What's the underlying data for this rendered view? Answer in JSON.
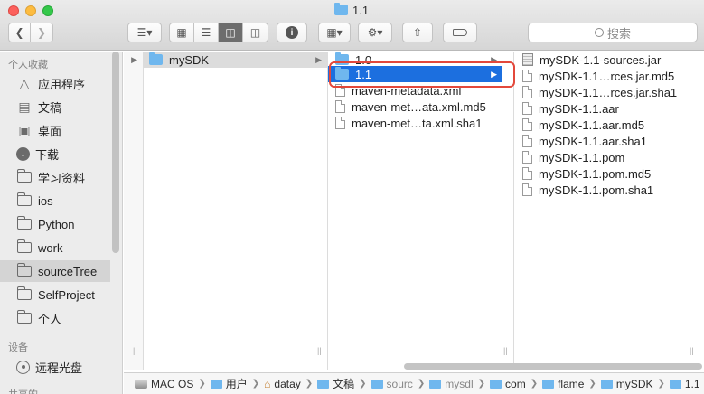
{
  "window": {
    "title": "1.1",
    "search_placeholder": "搜索"
  },
  "sidebar": {
    "sections": [
      {
        "label": "个人收藏"
      },
      {
        "label": "设备"
      },
      {
        "label": "共享的"
      }
    ],
    "items": [
      {
        "label": "应用程序",
        "icon": "apps-icon"
      },
      {
        "label": "文稿",
        "icon": "document-icon"
      },
      {
        "label": "桌面",
        "icon": "desktop-icon"
      },
      {
        "label": "下载",
        "icon": "download-icon"
      },
      {
        "label": "学习资料",
        "icon": "folder-icon"
      },
      {
        "label": "ios",
        "icon": "folder-icon"
      },
      {
        "label": "Python",
        "icon": "folder-icon"
      },
      {
        "label": "work",
        "icon": "folder-icon"
      },
      {
        "label": "sourceTree",
        "icon": "folder-icon",
        "selected": true
      },
      {
        "label": "SelfProject",
        "icon": "folder-icon"
      },
      {
        "label": "个人",
        "icon": "folder-icon"
      }
    ],
    "devices": [
      {
        "label": "远程光盘",
        "icon": "disc-icon"
      }
    ]
  },
  "columns": {
    "col1": [
      {
        "name": "mySDK",
        "type": "folder",
        "selected": true
      }
    ],
    "col2": [
      {
        "name": "1.0",
        "type": "folder"
      },
      {
        "name": "1.1",
        "type": "folder",
        "selected": true
      },
      {
        "name": "maven-metadata.xml",
        "type": "file"
      },
      {
        "name": "maven-met…ata.xml.md5",
        "type": "file"
      },
      {
        "name": "maven-met…ta.xml.sha1",
        "type": "file"
      }
    ],
    "col3": [
      {
        "name": "mySDK-1.1-sources.jar",
        "type": "jar"
      },
      {
        "name": "mySDK-1.1…rces.jar.md5",
        "type": "file"
      },
      {
        "name": "mySDK-1.1…rces.jar.sha1",
        "type": "file"
      },
      {
        "name": "mySDK-1.1.aar",
        "type": "file"
      },
      {
        "name": "mySDK-1.1.aar.md5",
        "type": "file"
      },
      {
        "name": "mySDK-1.1.aar.sha1",
        "type": "file"
      },
      {
        "name": "mySDK-1.1.pom",
        "type": "file"
      },
      {
        "name": "mySDK-1.1.pom.md5",
        "type": "file"
      },
      {
        "name": "mySDK-1.1.pom.sha1",
        "type": "file"
      }
    ]
  },
  "pathbar": [
    {
      "label": "MAC OS",
      "icon": "disk-icon"
    },
    {
      "label": "用户",
      "icon": "folder-icon"
    },
    {
      "label": "datay",
      "icon": "home-icon"
    },
    {
      "label": "文稿",
      "icon": "folder-icon"
    },
    {
      "label": "sourc",
      "icon": "folder-icon"
    },
    {
      "label": "mysdl",
      "icon": "folder-icon"
    },
    {
      "label": "com",
      "icon": "folder-icon"
    },
    {
      "label": "flame",
      "icon": "folder-icon"
    },
    {
      "label": "mySDK",
      "icon": "folder-icon"
    },
    {
      "label": "1.1",
      "icon": "folder-icon"
    }
  ],
  "colors": {
    "selection_blue": "#1c6fdf",
    "folder_blue": "#6fb7ee",
    "highlight_red": "#e3483b"
  }
}
